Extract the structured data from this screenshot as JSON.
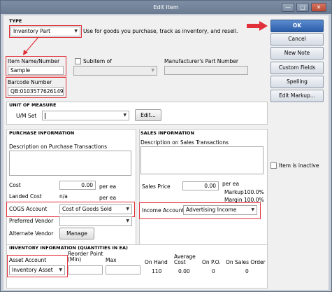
{
  "window": {
    "title": "Edit Item"
  },
  "type": {
    "heading": "TYPE",
    "value": "Inventory Part",
    "description": "Use for goods you purchase, track as inventory, and resell."
  },
  "item": {
    "name_label": "Item Name/Number",
    "name_value": "Sample",
    "subitem_label": "Subitem of",
    "mfr_label": "Manufacturer's Part Number",
    "barcode_label": "Barcode Number",
    "barcode_value": "QB:0103577626149"
  },
  "uom": {
    "heading": "UNIT OF MEASURE",
    "set_label": "U/M Set",
    "edit_label": "Edit..."
  },
  "purchase": {
    "heading": "PURCHASE INFORMATION",
    "desc_label": "Description on Purchase Transactions",
    "cost_label": "Cost",
    "cost_value": "0.00",
    "cost_unit": "per ea",
    "landed_label": "Landed Cost",
    "landed_value": "n/a",
    "landed_unit": "per ea",
    "cogs_label": "COGS Account",
    "cogs_value": "Cost of Goods Sold",
    "vendor_label": "Preferred Vendor",
    "alt_vendor_label": "Alternate Vendor",
    "manage_label": "Manage"
  },
  "sales": {
    "heading": "SALES INFORMATION",
    "desc_label": "Description on Sales Transactions",
    "price_label": "Sales Price",
    "price_value": "0.00",
    "price_unit": "per ea",
    "markup_label": "Markup",
    "markup_value": "100.0%",
    "margin_label": "Margin",
    "margin_value": "100.0%",
    "income_label": "Income Account",
    "income_value": "Advertising Income"
  },
  "inventory": {
    "heading": "INVENTORY INFORMATION (QUANTITIES IN EA)",
    "asset_label": "Asset Account",
    "asset_value": "Inventory Asset",
    "reorder_label": "Reorder Point (Min)",
    "max_label": "Max",
    "onhand_label": "On Hand",
    "onhand_value": "110",
    "avgcost_label": "Average Cost",
    "avgcost_value": "0.00",
    "onpo_label": "On P.O.",
    "onpo_value": "0",
    "onso_label": "On Sales Order",
    "onso_value": "0"
  },
  "sidebar": {
    "ok": "OK",
    "cancel": "Cancel",
    "new_note": "New Note",
    "custom_fields": "Custom Fields",
    "spelling": "Spelling",
    "edit_markup": "Edit Markup...",
    "inactive_label": "Item is inactive"
  },
  "colors": {
    "highlight": "#e0303a",
    "ok_button": "#2b5ca8"
  }
}
